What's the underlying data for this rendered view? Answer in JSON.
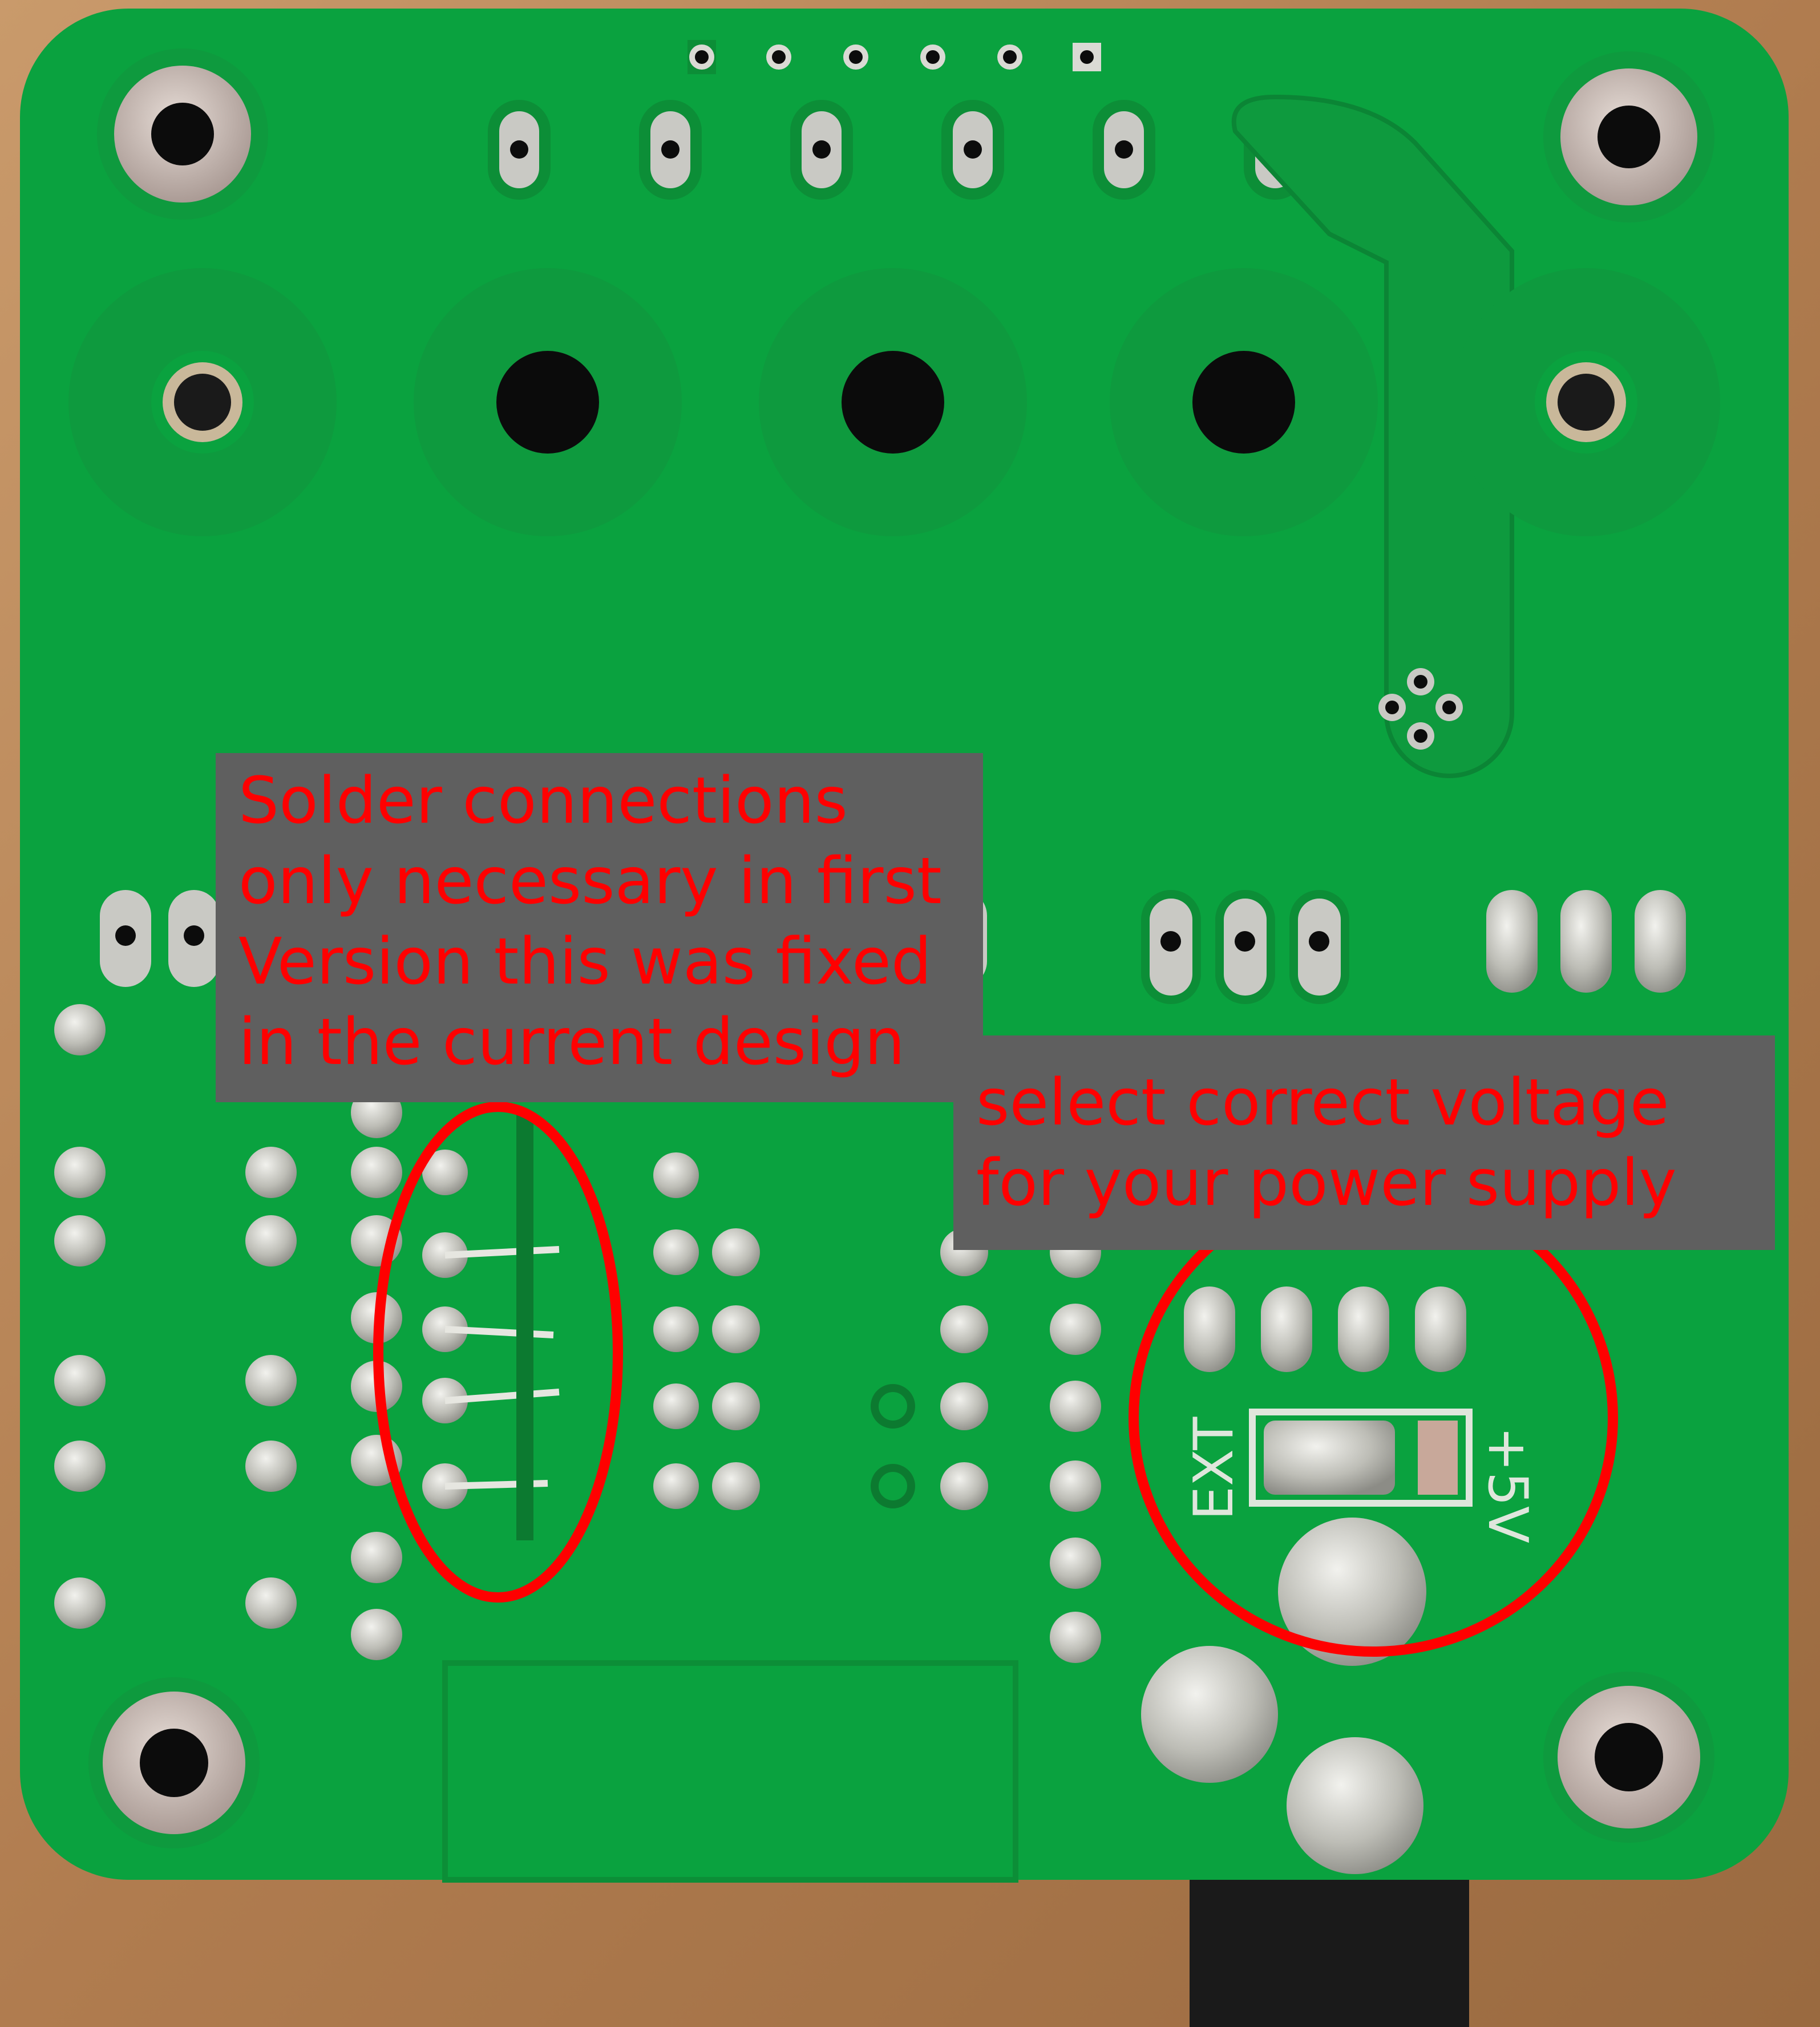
{
  "photo": {
    "subject": "printed-circuit-board-underside",
    "colors": {
      "board": "#0aa23f",
      "board_light": "#13b04c",
      "copper_fill": "#0e9a3e",
      "pad_silver": "#c9c9c4",
      "hole": "#0c0c0c",
      "wood": "#b8865a",
      "highlight": "#ff0000",
      "callout_bg": "#5f5f5f"
    }
  },
  "annotations": {
    "solder_note": {
      "lines": [
        "Solder connections",
        "only necessary in first",
        "Version this was fixed",
        "in the current design"
      ]
    },
    "voltage_note": {
      "lines": [
        "select correct voltage",
        "for your power supply"
      ]
    }
  },
  "silkscreen": {
    "ext_label": "EXT",
    "plus5v_label": "+5V"
  }
}
